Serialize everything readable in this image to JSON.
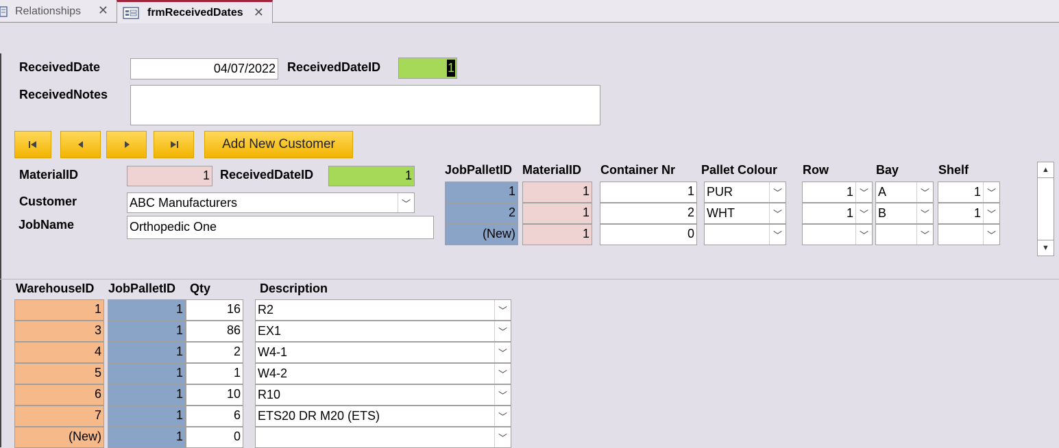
{
  "tabs": [
    {
      "label": "Relationships"
    },
    {
      "label": "frmReceivedDates"
    }
  ],
  "main_form": {
    "received_date_label": "ReceivedDate",
    "received_date_value": "04/07/2022",
    "received_date_id_label": "ReceivedDateID",
    "received_date_id_value": "1",
    "received_notes_label": "ReceivedNotes",
    "received_notes_value": ""
  },
  "nav_buttons": {
    "first_icon": "first-record-icon",
    "prev_icon": "previous-record-icon",
    "next_icon": "next-record-icon",
    "last_icon": "last-record-icon",
    "add_new_customer": "Add New Customer"
  },
  "material_form": {
    "material_id_label": "MaterialID",
    "material_id_value": "1",
    "received_date_id_label": "ReceivedDateID",
    "received_date_id_value": "1",
    "customer_label": "Customer",
    "customer_value": "ABC Manufacturers",
    "job_name_label": "JobName",
    "job_name_value": "Orthopedic One"
  },
  "pallet_grid": {
    "headers": [
      "JobPalletID",
      "MaterialID",
      "Container Nr",
      "Pallet Colour",
      "Row",
      "Bay",
      "Shelf"
    ],
    "rows": [
      {
        "job_pallet_id": "1",
        "material_id": "1",
        "container_nr": "1",
        "pallet_colour": "PUR",
        "row": "1",
        "bay": "A",
        "shelf": "1"
      },
      {
        "job_pallet_id": "2",
        "material_id": "1",
        "container_nr": "2",
        "pallet_colour": "WHT",
        "row": "1",
        "bay": "B",
        "shelf": "1"
      },
      {
        "job_pallet_id": "(New)",
        "material_id": "1",
        "container_nr": "0",
        "pallet_colour": "",
        "row": "",
        "bay": "",
        "shelf": ""
      }
    ]
  },
  "warehouse_grid": {
    "headers": [
      "WarehouseID",
      "JobPalletID",
      "Qty",
      "Description"
    ],
    "rows": [
      {
        "warehouse_id": "1",
        "job_pallet_id": "1",
        "qty": "16",
        "description": "R2"
      },
      {
        "warehouse_id": "3",
        "job_pallet_id": "1",
        "qty": "86",
        "description": "EX1"
      },
      {
        "warehouse_id": "4",
        "job_pallet_id": "1",
        "qty": "2",
        "description": "W4-1"
      },
      {
        "warehouse_id": "5",
        "job_pallet_id": "1",
        "qty": "1",
        "description": "W4-2"
      },
      {
        "warehouse_id": "6",
        "job_pallet_id": "1",
        "qty": "10",
        "description": "R10"
      },
      {
        "warehouse_id": "7",
        "job_pallet_id": "1",
        "qty": "6",
        "description": "ETS20 DR M20 (ETS)"
      },
      {
        "warehouse_id": "(New)",
        "job_pallet_id": "1",
        "qty": "0",
        "description": ""
      }
    ]
  },
  "colors": {
    "background": "#e3dfe9",
    "id_green": "#a6d957",
    "material_pink": "#efd2d2",
    "pallet_blue": "#8aa4c8",
    "warehouse_orange": "#f6b98a",
    "button_yellow": "#f3b400",
    "tab_accent": "#a0243c"
  }
}
